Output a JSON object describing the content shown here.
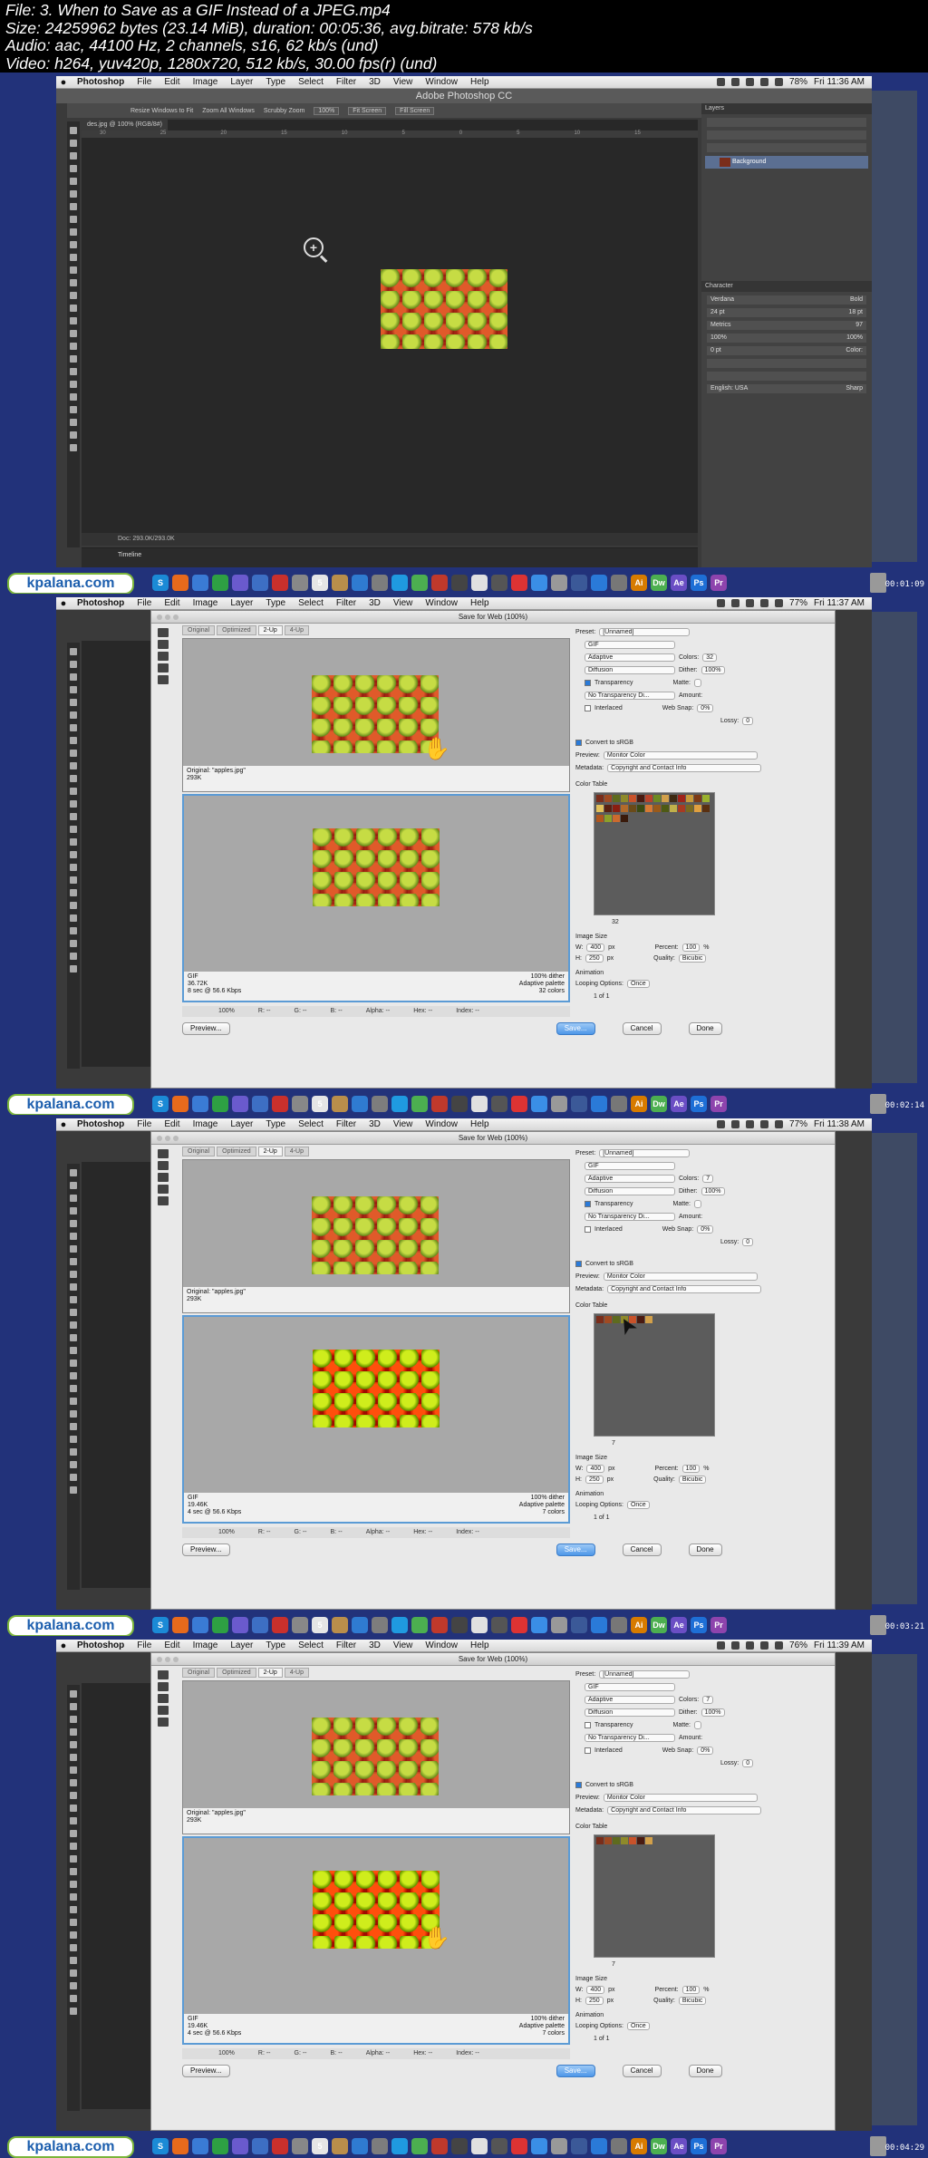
{
  "header": {
    "lines": [
      "File: 3. When to Save as a GIF Instead of a JPEG.mp4",
      "Size: 24259962 bytes (23.14 MiB), duration: 00:05:36, avg.bitrate: 578 kb/s",
      "Audio: aac, 44100 Hz, 2 channels, s16, 62 kb/s (und)",
      "Video: h264, yuv420p, 1280x720, 512 kb/s, 30.00 fps(r) (und)"
    ]
  },
  "menubar": {
    "app": "Photoshop",
    "items": [
      "File",
      "Edit",
      "Image",
      "Layer",
      "Type",
      "Select",
      "Filter",
      "3D",
      "View",
      "Window",
      "Help"
    ]
  },
  "frames": [
    {
      "timestamp": "00:01:09",
      "battery": "78%",
      "clock": "Fri 11:36 AM",
      "window_title": "Adobe Photoshop CC",
      "options_bar": [
        "Resize Windows to Fit",
        "Zoom All Windows",
        "Scrubby Zoom",
        "100%",
        "Fit Screen",
        "Fill Screen"
      ],
      "doc_tab": "des.jpg @ 100% (RGB/8#)",
      "doc_status": "Doc: 293.0K/293.0K",
      "timeline_label": "Timeline",
      "layers_title": "Layers",
      "layer_name": "Background",
      "character_title": "Character",
      "font": "Verdana",
      "font_style": "Bold",
      "font_size": "24 pt",
      "leading": "18 pt",
      "tracking": "Metrics",
      "tracking_val": "97",
      "scale_v": "100%",
      "scale_h": "100%",
      "baseline": "0 pt",
      "color_label": "Color:",
      "language": "English: USA",
      "aa": "Sharp"
    },
    {
      "timestamp": "00:02:14",
      "battery": "77%",
      "clock": "Fri 11:37 AM",
      "dialog_title": "Save for Web (100%)",
      "view_tabs": [
        "Original",
        "Optimized",
        "2-Up",
        "4-Up"
      ],
      "original_info": [
        "Original: \"apples.jpg\"",
        "293K"
      ],
      "optimized_left": [
        "GIF",
        "36.72K",
        "8 sec @ 56.6 Kbps"
      ],
      "optimized_right": [
        "100% dither",
        "Adaptive palette",
        "32 colors"
      ],
      "preset": "[Unnamed]",
      "format": "GIF",
      "reduction": "Adaptive",
      "colors": "32",
      "dither_algo": "Diffusion",
      "dither": "100%",
      "transparency": true,
      "matte_label": "Matte:",
      "trans_dither": "No Transparency Di...",
      "amount_label": "Amount:",
      "interlaced_label": "Interlaced",
      "web_snap": "0%",
      "lossy": "0",
      "convert_srgb": "Convert to sRGB",
      "preview_label": "Preview:",
      "preview_val": "Monitor Color",
      "metadata_label": "Metadata:",
      "metadata_val": "Copyright and Contact Info",
      "color_table_label": "Color Table",
      "color_count": "32",
      "swatches": [
        "#7a2d1a",
        "#a04a22",
        "#5e6b1e",
        "#8e8a2a",
        "#c9522a",
        "#4a1a10",
        "#b8432a",
        "#6d8a22",
        "#d2a04a",
        "#3e2a12",
        "#a0231a",
        "#c89a3a",
        "#7d3a14",
        "#9ab22e",
        "#e2c05a",
        "#5a2010",
        "#8a1e10",
        "#b26a2a",
        "#6a4a18",
        "#3a4a12",
        "#d67a34",
        "#9a5a1a",
        "#4e5a14",
        "#c0b04a",
        "#a83a22",
        "#7a6a20",
        "#e0a040",
        "#5a3010",
        "#b0561e",
        "#8ca02a",
        "#cc6a2e",
        "#3a1a0a"
      ],
      "image_size_label": "Image Size",
      "width": "400",
      "height": "250",
      "percent": "100",
      "quality": "Bicubic",
      "animation_label": "Animation",
      "looping": "Once",
      "frame_of": "1 of 1",
      "bottom_zoom": "100%",
      "bottom_fields": [
        "R: --",
        "G: --",
        "B: --",
        "Alpha: --",
        "Hex: --",
        "Index: --"
      ],
      "buttons": [
        "Preview...",
        "Save...",
        "Cancel",
        "Done"
      ]
    },
    {
      "timestamp": "00:03:21",
      "battery": "77%",
      "clock": "Fri 11:38 AM",
      "optimized_left": [
        "GIF",
        "19.46K",
        "4 sec @ 56.6 Kbps"
      ],
      "optimized_right": [
        "100% dither",
        "Adaptive palette",
        "7 colors"
      ],
      "colors": "7",
      "transparency": true,
      "color_count": "7",
      "swatches": [
        "#7a2d1a",
        "#a04a22",
        "#5e6b1e",
        "#8e8a2a",
        "#c9522a",
        "#4a1a10",
        "#d2a04a"
      ]
    },
    {
      "timestamp": "00:04:29",
      "battery": "76%",
      "clock": "Fri 11:39 AM",
      "optimized_left": [
        "GIF",
        "19.46K",
        "4 sec @ 56.6 Kbps"
      ],
      "optimized_right": [
        "100% dither",
        "Adaptive palette",
        "7 colors"
      ],
      "colors": "7",
      "transparency": false,
      "color_count": "7",
      "swatches": [
        "#7a2d1a",
        "#a04a22",
        "#5e6b1e",
        "#8e8a2a",
        "#c9522a",
        "#4a1a10",
        "#d2a04a"
      ]
    }
  ],
  "watermark": "kpalana.com",
  "dock_icons": [
    {
      "label": "S",
      "color": "#1b8ad6"
    },
    {
      "label": "",
      "color": "#e76a1c"
    },
    {
      "label": "",
      "color": "#3a7bd5"
    },
    {
      "label": "",
      "color": "#2ea043"
    },
    {
      "label": "",
      "color": "#6a5acd"
    },
    {
      "label": "",
      "color": "#3d6fc4"
    },
    {
      "label": "",
      "color": "#c9302c"
    },
    {
      "label": "",
      "color": "#888"
    },
    {
      "label": "5",
      "color": "#e5e5e5"
    },
    {
      "label": "",
      "color": "#b98e4b"
    },
    {
      "label": "",
      "color": "#2f7bd1"
    },
    {
      "label": "",
      "color": "#7d7d7d"
    },
    {
      "label": "",
      "color": "#1f9ae0"
    },
    {
      "label": "",
      "color": "#4caf50"
    },
    {
      "label": "",
      "color": "#c0392b"
    },
    {
      "label": "",
      "color": "#444"
    },
    {
      "label": "",
      "color": "#e0e0e0"
    },
    {
      "label": "",
      "color": "#555"
    },
    {
      "label": "",
      "color": "#d33"
    },
    {
      "label": "",
      "color": "#3a8ee6"
    },
    {
      "label": "",
      "color": "#999"
    },
    {
      "label": "",
      "color": "#3b5998"
    },
    {
      "label": "",
      "color": "#2a7ad8"
    },
    {
      "label": "",
      "color": "#777"
    },
    {
      "label": "Ai",
      "color": "#d77b00"
    },
    {
      "label": "Dw",
      "color": "#4caf50"
    },
    {
      "label": "Ae",
      "color": "#6b4ec4"
    },
    {
      "label": "Ps",
      "color": "#1e6fd6"
    },
    {
      "label": "Pr",
      "color": "#8e44ad"
    }
  ]
}
